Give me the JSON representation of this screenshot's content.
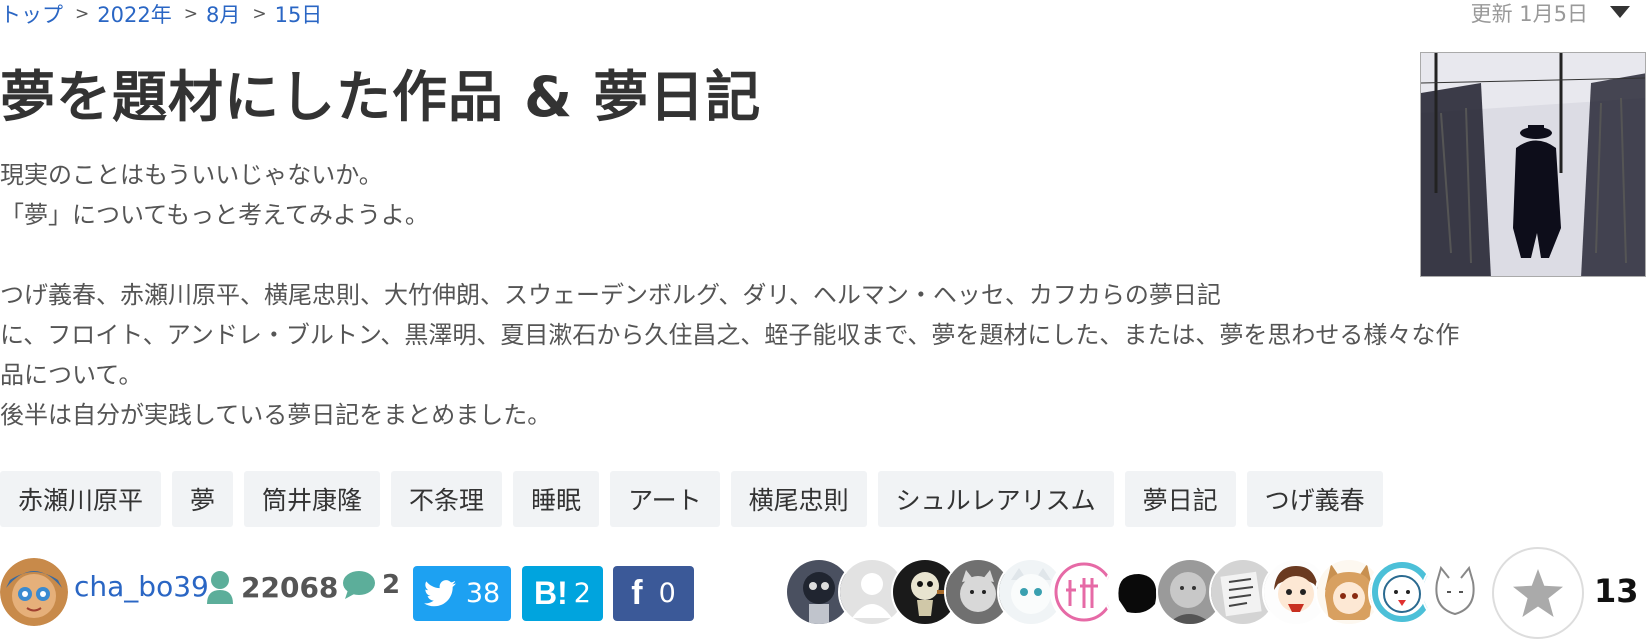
{
  "breadcrumb": {
    "top": "トップ",
    "year": "2022年",
    "month": "8月",
    "day": "15日",
    "separator": ">"
  },
  "updated": {
    "label": "更新 1月5日"
  },
  "title": "夢を題材にした作品 & 夢日記",
  "description": {
    "p1": "現実のことはもういいじゃないか。\n「夢」についてもっと考えてみようよ。",
    "p2": "つげ義春、赤瀬川原平、横尾忠則、大竹伸朗、スウェーデンボルグ、ダリ、ヘルマン・ヘッセ、カフカらの夢日記\nに、フロイト、アンドレ・ブルトン、黒澤明、夏目漱石から久住昌之、蛭子能収まで、夢を題材にした、または、夢を思わせる様々な作\n品について。\n後半は自分が実践している夢日記をまとめました。"
  },
  "tags": [
    "赤瀬川原平",
    "夢",
    "筒井康隆",
    "不条理",
    "睡眠",
    "アート",
    "横尾忠則",
    "シュルレアリスム",
    "夢日記",
    "つげ義春"
  ],
  "author": {
    "name": "cha_bo39",
    "views": "22068",
    "comments": "2"
  },
  "share": {
    "twitter": "38",
    "hatena_label": "B!",
    "hatena": "2",
    "facebook_label": "f",
    "facebook": "0"
  },
  "stars": {
    "count": "13"
  },
  "colors": {
    "link": "#2a66c4",
    "twitter": "#1da1f2",
    "hatena": "#00a4de",
    "facebook": "#3b5998",
    "tag_bg": "#f1f3f5",
    "user_icon": "#5cae9a"
  }
}
